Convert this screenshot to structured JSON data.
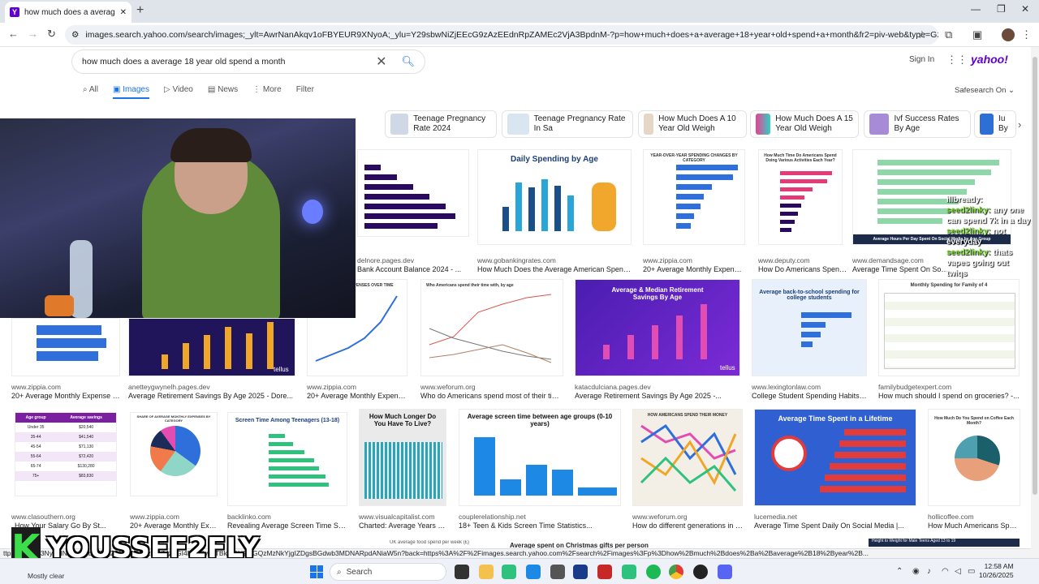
{
  "browser": {
    "tab_title": "how much does a average 18 y",
    "tab_favicon": "Y",
    "url": "images.search.yahoo.com/search/images;_ylt=AwrNanAkqv1oFBYEUR9XNyoA;_ylu=Y29sbwNiZjEEcG9zAzEEdnRpZAMEc2VjA3BpdnM-?p=how+much+does+a+average+18+year+old+spend+a+month&fr2=piv-web&type=G211US714G91962M4..."
  },
  "header": {
    "search_query": "how much does a average 18 year old spend a month",
    "sign_in": "Sign In",
    "logo": "yahoo!",
    "tabs": [
      "All",
      "Images",
      "Video",
      "News",
      "More",
      "Filter"
    ],
    "safesearch": "Safesearch On"
  },
  "related": [
    {
      "label": "Teenage Pregnancy Rate 2024",
      "color": "#cfd8e6"
    },
    {
      "label": "Teenage Pregnancy Rate In Sa",
      "color": "#d9e6f2"
    },
    {
      "label": "How Much Does A 10 Year Old Weigh",
      "color": "#e6d6c8"
    },
    {
      "label": "How Much Does A 15 Year Old Weigh",
      "color": "#ec3f8f"
    },
    {
      "label": "Ivf Success Rates By Age",
      "color": "#a88bd6"
    },
    {
      "label": "Iu By",
      "color": "#2e6fd6"
    }
  ],
  "results": {
    "row1": [
      {
        "src": "delnore.pages.dev",
        "cap": "Bank Account Balance 2024 - ..."
      },
      {
        "src": "www.gobankingrates.com",
        "cap": "How Much Does the Average American Spend Per...",
        "title": "Daily Spending by Age"
      },
      {
        "src": "www.zippia.com",
        "cap": "20+ Average Monthly Expense St...",
        "title": "YEAR-OVER-YEAR SPENDING CHANGES BY CATEGORY"
      },
      {
        "src": "www.deputy.com",
        "cap": "How Do Americans Spend...",
        "title": "How Much Time Do Americans Spend Doing Various Activities Each Year?"
      },
      {
        "src": "www.demandsage.com",
        "cap": "Average Time Spent On Social Media by...",
        "title": "Average Hours Per Day Spent On Social Media by Age Group"
      }
    ],
    "row2": [
      {
        "src": "www.zippia.com",
        "cap": "20+ Average Monthly Expense Sta..."
      },
      {
        "src": "anetteygwynelh.pages.dev",
        "cap": "Average Retirement Savings By Age 2025 - Dore...",
        "brand": "tellus"
      },
      {
        "src": "www.zippia.com",
        "cap": "20+ Average Monthly Expense St...",
        "title": "HOUSEHOLD EXPENSES OVER TIME"
      },
      {
        "src": "www.weforum.org",
        "cap": "Who do Americans spend most of their time...",
        "title": "Who Americans spend their time with, by age"
      },
      {
        "src": "katacdulciana.pages.dev",
        "cap": "Average Retirement Savings By Age 2025 -...",
        "title": "Average & Median Retirement Savings By Age",
        "brand": "tellus"
      },
      {
        "src": "www.lexingtonlaw.com",
        "cap": "College Student Spending Habits for...",
        "title": "Average back-to-school spending for college students"
      },
      {
        "src": "familybudgetexpert.com",
        "cap": "How much should I spend on groceries? -...",
        "title": "Monthly Spending for Family of 4"
      }
    ],
    "row3": [
      {
        "src": "www.clasouthern.org",
        "cap": "How Your Salary Go By St...",
        "headers": [
          "Age group",
          "Average savings"
        ],
        "rows": [
          [
            "Under 35",
            "$20,540"
          ],
          [
            "35-44",
            "$41,540"
          ],
          [
            "45-54",
            "$71,130"
          ],
          [
            "55-64",
            "$72,420"
          ],
          [
            "65-74",
            "$130,280"
          ],
          [
            "75+",
            "$83,830"
          ]
        ]
      },
      {
        "src": "www.zippia.com",
        "cap": "20+ Average Monthly Exp...",
        "title": "SHARE OF AVERAGE MONTHLY EXPENSES BY CATEGORY"
      },
      {
        "src": "backlinko.com",
        "cap": "Revealing Average Screen Time Statisti...",
        "title": "Screen Time Among Teenagers (13-18)"
      },
      {
        "src": "www.visualcapitalist.com",
        "cap": "Charted: Average Years Left...",
        "title": "How Much Longer Do You Have To Live?"
      },
      {
        "src": "couplerelationship.net",
        "cap": "18+ Teen & Kids Screen Time Statistics...",
        "title": "Average screen time between age groups (0-10 years)"
      },
      {
        "src": "www.weforum.org",
        "cap": "How do different generations in the ...",
        "title": "HOW AMERICANS SPEND THEIR MONEY"
      },
      {
        "src": "lucemedia.net",
        "cap": "Average Time Spent Daily On Social Media |...",
        "title": "Average Time Spent in a Lifetime"
      },
      {
        "src": "hollicoffee.com",
        "cap": "How Much Americans Spend ...",
        "title": "How Much Do You Spend on Coffee Each Month?"
      }
    ],
    "bottom_strip": [
      "UK average food spend per week (£)",
      "Average spent on Christmas gifts per person",
      "Height to Weight for Male Teens Aged 13 to 19"
    ]
  },
  "chat": [
    {
      "user": "",
      "msg": "illbready:"
    },
    {
      "user": "seed2linky:",
      "msg": "any one can spend 7k in a day"
    },
    {
      "user": "seed2linky:",
      "msg": "not everyday"
    },
    {
      "user": "seed2linky:",
      "msg": "thats vapes going out"
    },
    {
      "user": "",
      "msg": "twiqs"
    }
  ],
  "status_url": "ttps://...2VjA3NyBHNsawNpbWEbll2kAzAzODkzOWMzZGI4MWQwNTBkOGU2MGQzMzNkYjgIZDgsBGdwb3MDNARpdANiaW5n?back=https%3A%2F%2Fimages.search.yahoo.com%2Fsearch%2Fimages%3Fp%3Dhow%2Bmuch%2Bdoes%2Ba%2Baverage%2B18%2Byear%2B...",
  "streamer": {
    "logo_letter": "K",
    "handle": "YOUSSEF2FLY"
  },
  "taskbar": {
    "weather": "Mostly clear",
    "search_label": "Search",
    "time": "12:58 AM",
    "date": "10/26/2025"
  }
}
